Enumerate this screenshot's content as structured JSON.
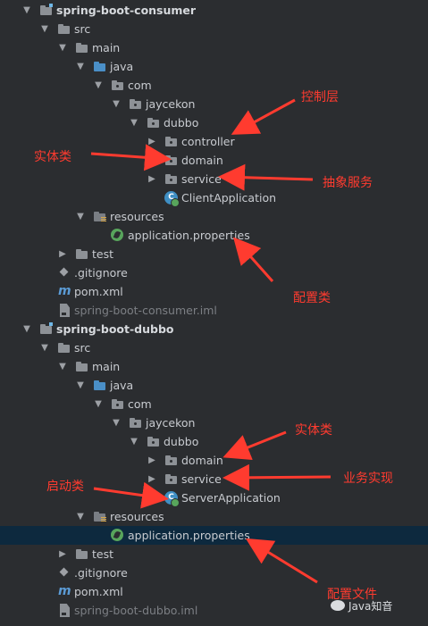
{
  "tree": {
    "consumer_project": "spring-boot-consumer",
    "src": "src",
    "main": "main",
    "java": "java",
    "com": "com",
    "jaycekon": "jaycekon",
    "dubbo": "dubbo",
    "controller": "controller",
    "domain": "domain",
    "service": "service",
    "client_app": "ClientApplication",
    "resources": "resources",
    "app_props": "application.properties",
    "test": "test",
    "gitignore": ".gitignore",
    "pom": "pom.xml",
    "consumer_iml": "spring-boot-consumer.iml",
    "dubbo_project": "spring-boot-dubbo",
    "src2": "src",
    "main2": "main",
    "java2": "java",
    "com2": "com",
    "jaycekon2": "jaycekon",
    "dubbo2": "dubbo",
    "domain2": "domain",
    "service2": "service",
    "server_app": "ServerApplication",
    "resources2": "resources",
    "app_props2": "application.properties",
    "test2": "test",
    "gitignore2": ".gitignore",
    "pom2": "pom.xml",
    "dubbo_iml": "spring-boot-dubbo.iml",
    "selected_item": "application.properties"
  },
  "annotations": {
    "controller_layer": "控制层",
    "entity_class_1": "实体类",
    "abstract_service": "抽象服务",
    "config_class": "配置类",
    "entity_class_2": "实体类",
    "business_impl": "业务实现",
    "startup_class": "启动类",
    "config_file": "配置文件"
  },
  "watermark": "Java知音",
  "colors": {
    "background": "#2b2d30",
    "selected_row": "#0d293e",
    "annotation_red": "#ff3b2f",
    "folder_blue": "#4a8fc7",
    "spring_green": "#58a55c"
  },
  "icons": {
    "expand": "chevron-down-icon",
    "collapse": "chevron-right-icon",
    "folder": "folder-icon",
    "source_folder": "source-folder-icon",
    "package": "package-icon",
    "resources": "resources-folder-icon",
    "spring_properties": "spring-leaf-icon",
    "class": "class-icon",
    "git": "git-icon",
    "maven": "maven-icon",
    "iml": "iml-file-icon"
  }
}
